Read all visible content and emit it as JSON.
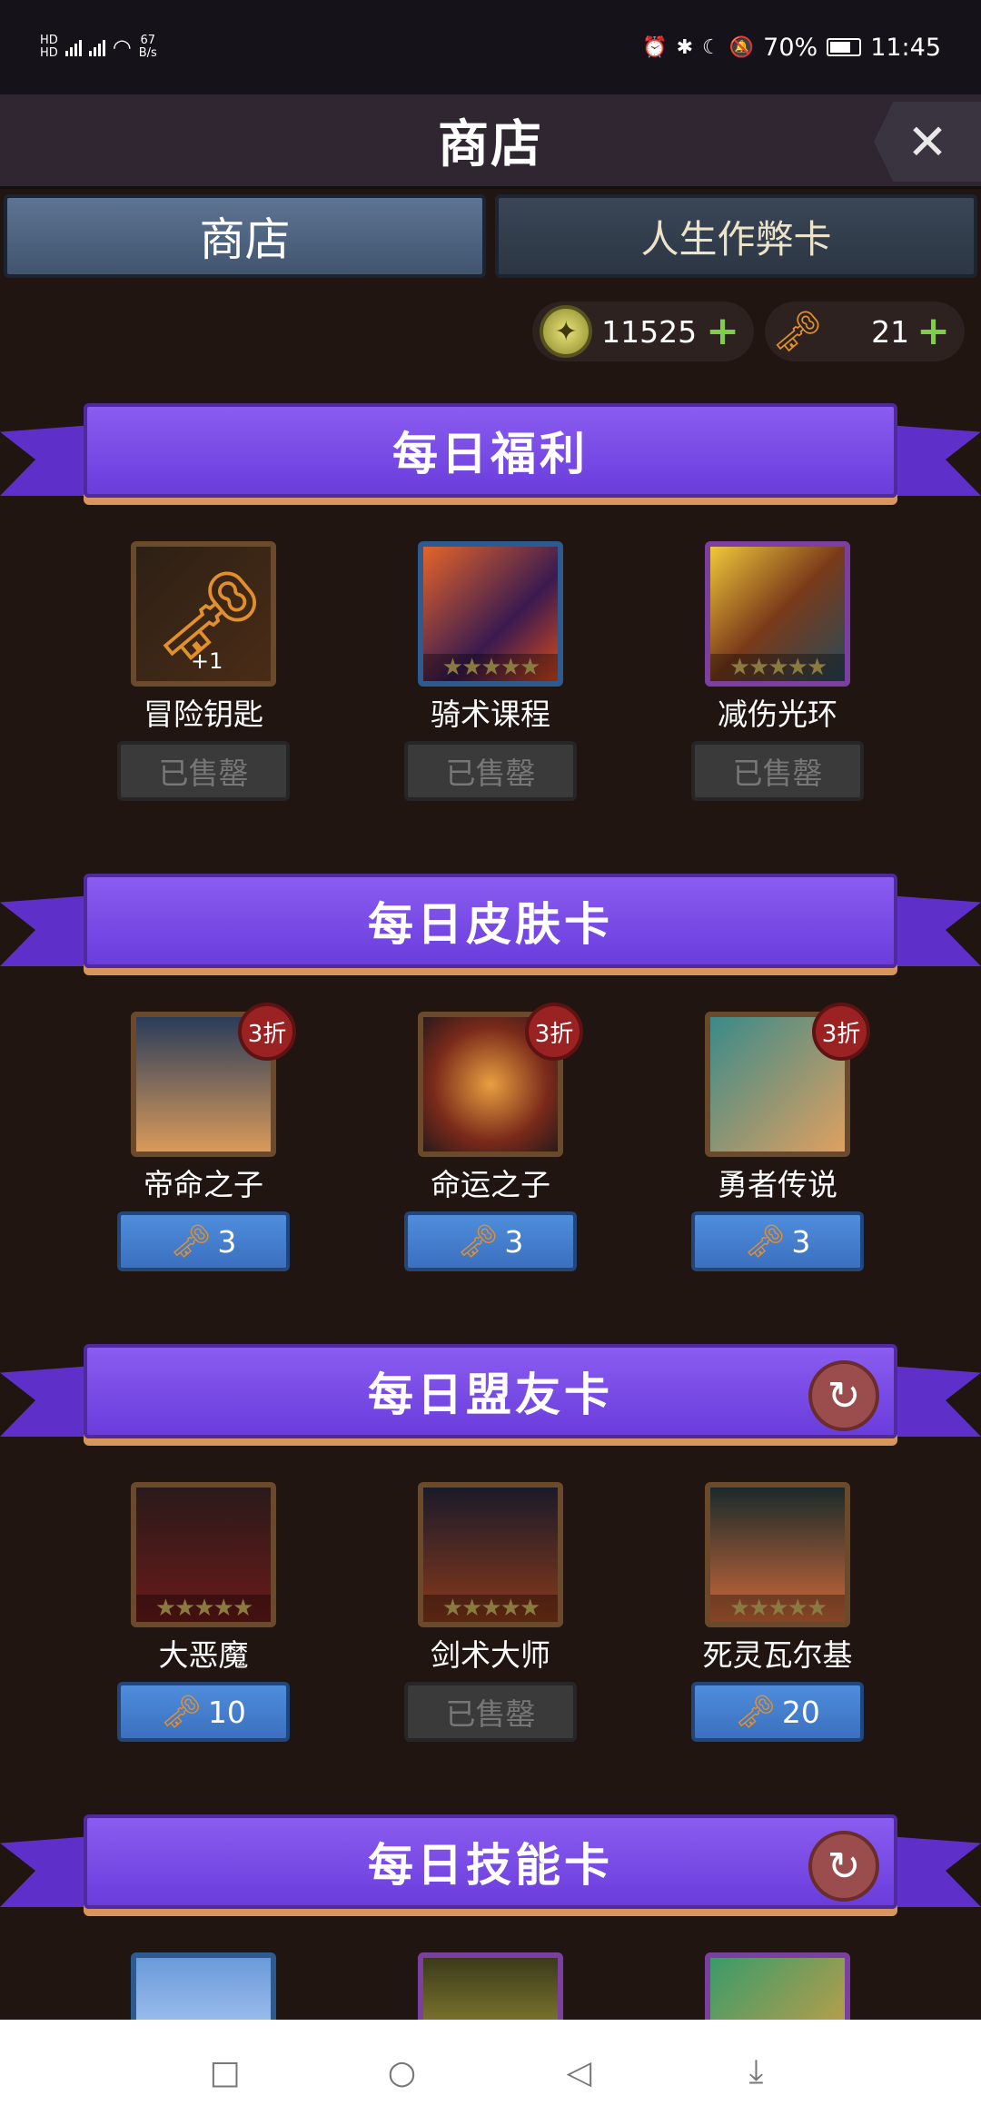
{
  "status": {
    "network_rate": "67",
    "network_unit": "B/s",
    "battery": "70%",
    "time": "11:45"
  },
  "header": {
    "title": "商店",
    "close": "✕"
  },
  "tabs": [
    "商店",
    "人生作弊卡"
  ],
  "currency": {
    "gems": "11525",
    "keys": "21"
  },
  "sections": {
    "daily_welfare": {
      "title": "每日福利",
      "items": [
        {
          "name": "冒险钥匙",
          "button": "已售罄",
          "extra": "+1"
        },
        {
          "name": "骑术课程",
          "button": "已售罄"
        },
        {
          "name": "减伤光环",
          "button": "已售罄"
        }
      ]
    },
    "daily_skin": {
      "title": "每日皮肤卡",
      "items": [
        {
          "name": "帝命之子",
          "price": "3",
          "badge": "3折"
        },
        {
          "name": "命运之子",
          "price": "3",
          "badge": "3折"
        },
        {
          "name": "勇者传说",
          "price": "3",
          "badge": "3折"
        }
      ]
    },
    "daily_ally": {
      "title": "每日盟友卡",
      "items": [
        {
          "name": "大恶魔",
          "price": "10"
        },
        {
          "name": "剑术大师",
          "button": "已售罄"
        },
        {
          "name": "死灵瓦尔基",
          "price": "20"
        }
      ]
    },
    "daily_skill": {
      "title": "每日技能卡"
    }
  },
  "icons": {
    "refresh": "↻",
    "key": "🗝",
    "star": "★"
  },
  "colors": {
    "ribbon": "#7b4ce6",
    "buy_button": "#4a86d4",
    "badge": "#9a2222"
  }
}
